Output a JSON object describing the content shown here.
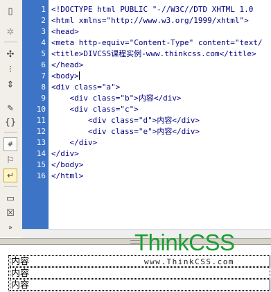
{
  "toolbar": {
    "icons": [
      "new-document-icon",
      "gear-icon",
      "expand-all-icon",
      "select-block-icon",
      "collapse-icon",
      "tag-inspector-icon",
      "brace-match-icon",
      "line-numbers-icon",
      "highlight-invalid-icon",
      "word-wrap-icon",
      "comment-icon",
      "remove-comment-icon",
      "more-icon"
    ]
  },
  "editor": {
    "line_numbers": [
      "1",
      "2",
      "3",
      "4",
      "5",
      "6",
      "7",
      "8",
      "9",
      "10",
      "11",
      "12",
      "13",
      "14",
      "15",
      "16"
    ],
    "lines": [
      "<!DOCTYPE html PUBLIC \"-//W3C//DTD XHTML 1.0 ",
      "<html xmlns=\"http://www.w3.org/1999/xhtml\">",
      "<head>",
      "<meta http-equiv=\"Content-Type\" content=\"text/",
      "<title>DIVCSS课程实例-www.thinkcss.com</title>",
      "</head>",
      "<body>",
      "<div class=\"a\">",
      "    <div class=\"b\">内容</div>",
      "    <div class=\"c\">",
      "        <div class=\"d\">内容</div>",
      "        <div class=\"e\">内容</div>",
      "    </div>",
      "</div>",
      "</body>",
      "</html>"
    ]
  },
  "logo": {
    "main": "ThinkCSS",
    "sub": "www.ThinkCSS.com"
  },
  "preview": {
    "items": [
      "内容",
      "内容",
      "内容"
    ]
  },
  "colors": {
    "gutter": "#3d74c6",
    "code_text": "#000080",
    "logo_green": "#1a9f33"
  }
}
